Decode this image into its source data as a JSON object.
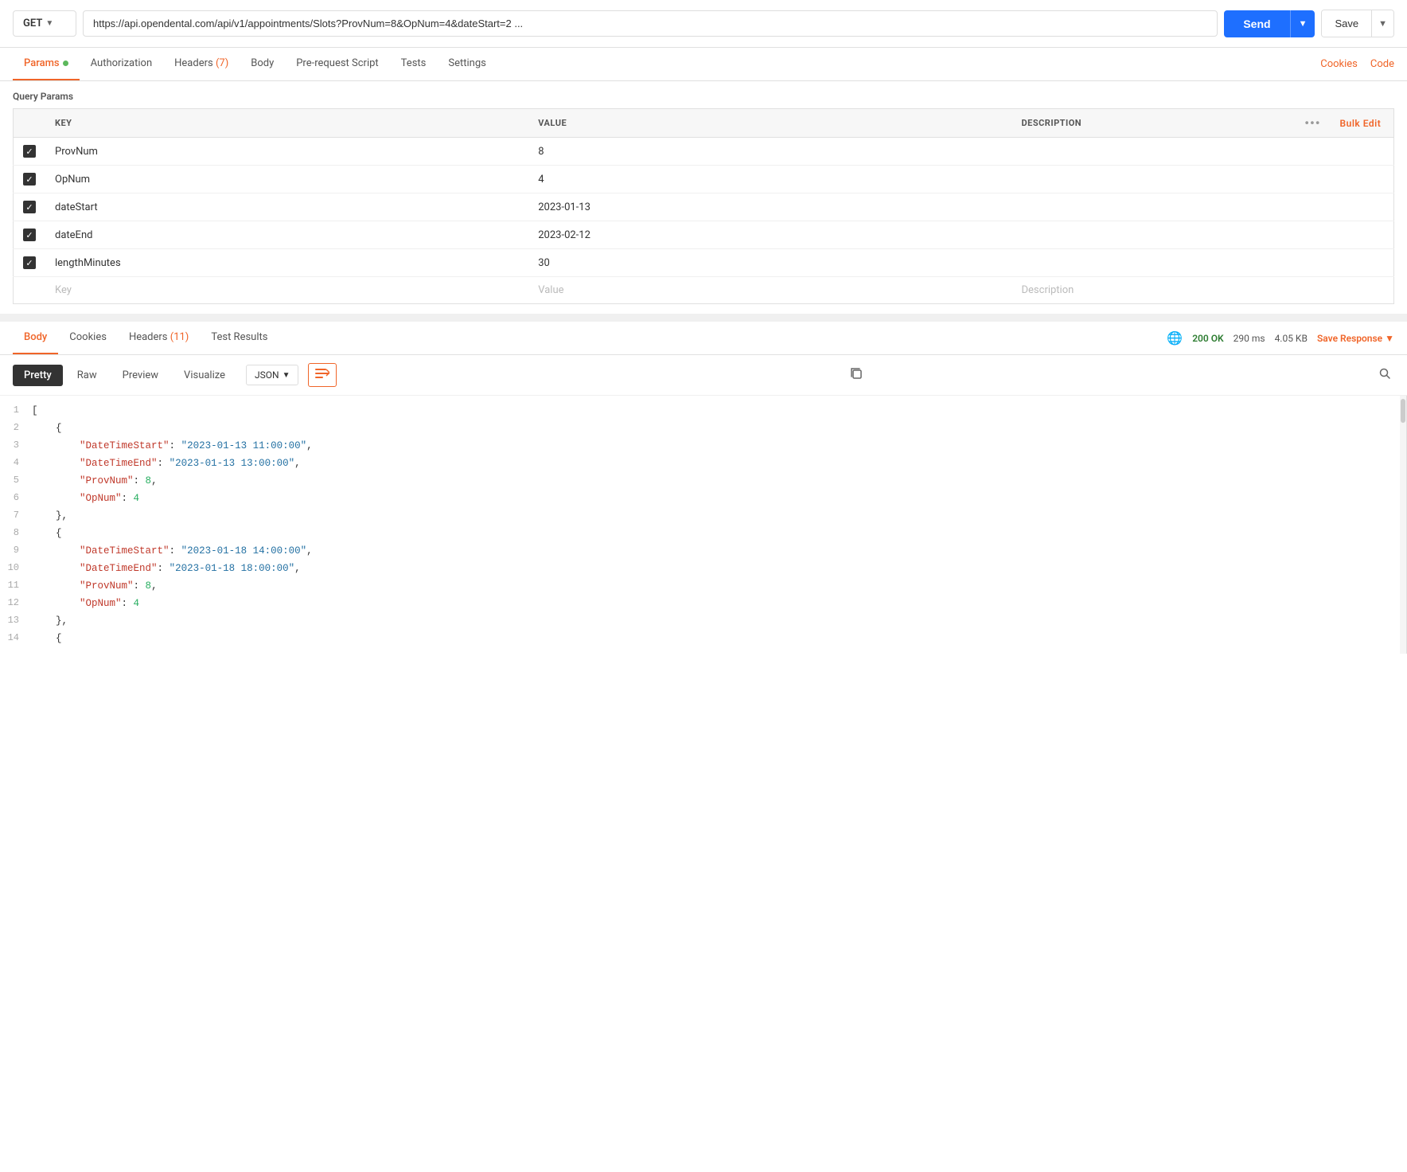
{
  "method": {
    "value": "GET",
    "label": "GET"
  },
  "url": {
    "value": "https://api.opendental.com/api/v1/appointments/Slots?ProvNum=8&OpNum=4&dateStart=2 ..."
  },
  "send_button": {
    "label": "Send"
  },
  "save_button": {
    "label": "Save"
  },
  "request_tabs": [
    {
      "id": "params",
      "label": "Params",
      "active": true,
      "dot": true,
      "count": null
    },
    {
      "id": "authorization",
      "label": "Authorization",
      "active": false,
      "dot": false,
      "count": null
    },
    {
      "id": "headers",
      "label": "Headers",
      "active": false,
      "dot": false,
      "count": 7
    },
    {
      "id": "body",
      "label": "Body",
      "active": false,
      "dot": false,
      "count": null
    },
    {
      "id": "prerequest",
      "label": "Pre-request Script",
      "active": false,
      "dot": false,
      "count": null
    },
    {
      "id": "tests",
      "label": "Tests",
      "active": false,
      "dot": false,
      "count": null
    },
    {
      "id": "settings",
      "label": "Settings",
      "active": false,
      "dot": false,
      "count": null
    }
  ],
  "right_links": [
    {
      "id": "cookies",
      "label": "Cookies"
    },
    {
      "id": "code",
      "label": "Code"
    }
  ],
  "query_params": {
    "section_title": "Query Params",
    "columns": {
      "key": "KEY",
      "value": "VALUE",
      "description": "DESCRIPTION",
      "bulk_edit": "Bulk Edit"
    },
    "rows": [
      {
        "checked": true,
        "key": "ProvNum",
        "value": "8",
        "description": ""
      },
      {
        "checked": true,
        "key": "OpNum",
        "value": "4",
        "description": ""
      },
      {
        "checked": true,
        "key": "dateStart",
        "value": "2023-01-13",
        "description": ""
      },
      {
        "checked": true,
        "key": "dateEnd",
        "value": "2023-02-12",
        "description": ""
      },
      {
        "checked": true,
        "key": "lengthMinutes",
        "value": "30",
        "description": ""
      }
    ],
    "placeholder_row": {
      "key": "Key",
      "value": "Value",
      "description": "Description"
    }
  },
  "response_tabs": [
    {
      "id": "body",
      "label": "Body",
      "active": true
    },
    {
      "id": "cookies",
      "label": "Cookies",
      "active": false
    },
    {
      "id": "headers",
      "label": "Headers",
      "active": false,
      "count": 11
    },
    {
      "id": "test_results",
      "label": "Test Results",
      "active": false
    }
  ],
  "response_meta": {
    "status": "200 OK",
    "time": "290 ms",
    "size": "4.05 KB",
    "save_label": "Save Response"
  },
  "format_tabs": [
    {
      "id": "pretty",
      "label": "Pretty",
      "active": true
    },
    {
      "id": "raw",
      "label": "Raw",
      "active": false
    },
    {
      "id": "preview",
      "label": "Preview",
      "active": false
    },
    {
      "id": "visualize",
      "label": "Visualize",
      "active": false
    }
  ],
  "json_format": "JSON",
  "json_lines": [
    {
      "num": 1,
      "content": "["
    },
    {
      "num": 2,
      "content": "    {"
    },
    {
      "num": 3,
      "key": "DateTimeStart",
      "value": "2023-01-13 11:00:00",
      "type": "string",
      "comma": true
    },
    {
      "num": 4,
      "key": "DateTimeEnd",
      "value": "2023-01-13 13:00:00",
      "type": "string",
      "comma": true
    },
    {
      "num": 5,
      "key": "ProvNum",
      "value": "8",
      "type": "number",
      "comma": true
    },
    {
      "num": 6,
      "key": "OpNum",
      "value": "4",
      "type": "number",
      "comma": false
    },
    {
      "num": 7,
      "content": "    },"
    },
    {
      "num": 8,
      "content": "    {"
    },
    {
      "num": 9,
      "key": "DateTimeStart",
      "value": "2023-01-18 14:00:00",
      "type": "string",
      "comma": true
    },
    {
      "num": 10,
      "key": "DateTimeEnd",
      "value": "2023-01-18 18:00:00",
      "type": "string",
      "comma": true
    },
    {
      "num": 11,
      "key": "ProvNum",
      "value": "8",
      "type": "number",
      "comma": true
    },
    {
      "num": 12,
      "key": "OpNum",
      "value": "4",
      "type": "number",
      "comma": false
    },
    {
      "num": 13,
      "content": "    },"
    },
    {
      "num": 14,
      "content": "    {"
    }
  ]
}
